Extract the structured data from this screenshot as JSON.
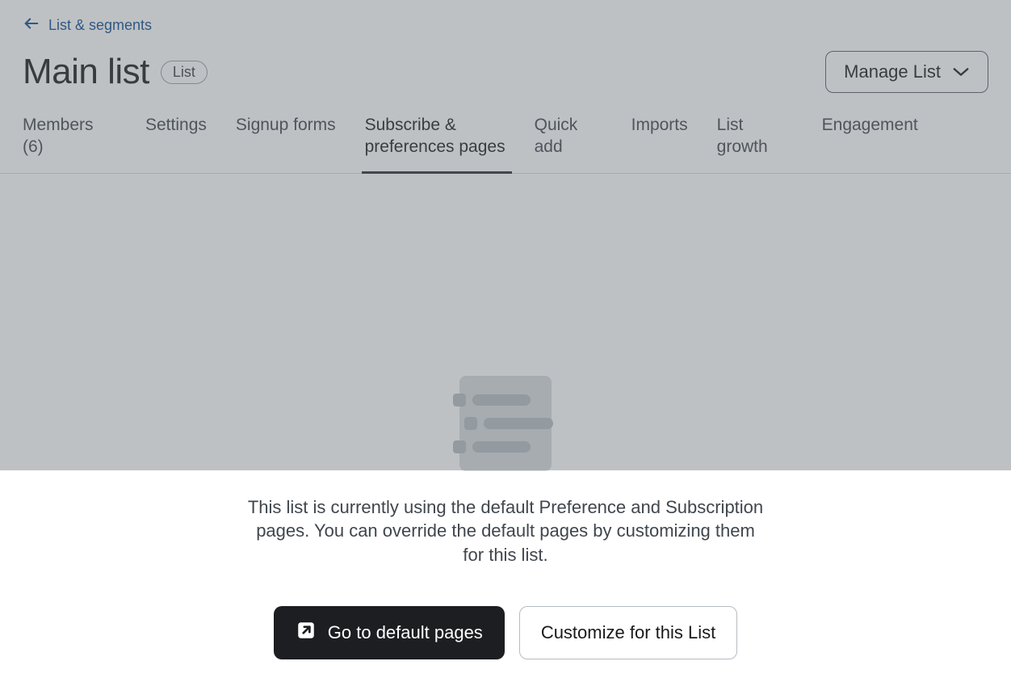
{
  "breadcrumb": {
    "back_label": "List & segments"
  },
  "header": {
    "title": "Main list",
    "badge": "List",
    "manage_button": "Manage List"
  },
  "tabs": [
    {
      "label": "Members (6)"
    },
    {
      "label": "Settings"
    },
    {
      "label": "Signup forms"
    },
    {
      "label": "Subscribe & preferences pages",
      "active": true
    },
    {
      "label": "Quick add"
    },
    {
      "label": "Imports"
    },
    {
      "label": "List growth"
    },
    {
      "label": "Engagement"
    }
  ],
  "empty_state": {
    "message": "This list is currently using the default Preference and Subscription pages. You can override the default pages by customizing them for this list.",
    "primary_button": "Go to default pages",
    "secondary_button": "Customize for this List"
  }
}
